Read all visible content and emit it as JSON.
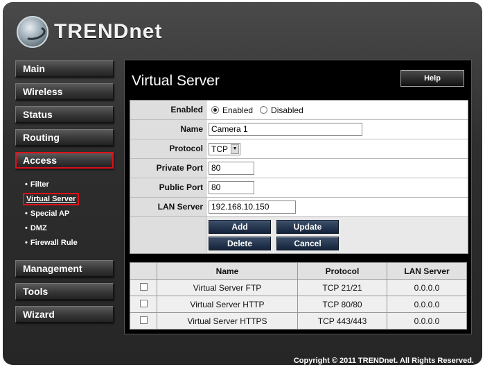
{
  "brand": {
    "name": "TRENDnet"
  },
  "sidebar": {
    "items": [
      {
        "label": "Main"
      },
      {
        "label": "Wireless"
      },
      {
        "label": "Status"
      },
      {
        "label": "Routing"
      },
      {
        "label": "Access"
      },
      {
        "label": "Management"
      },
      {
        "label": "Tools"
      },
      {
        "label": "Wizard"
      }
    ],
    "access_sub": [
      {
        "label": "Filter"
      },
      {
        "label": "Virtual Server"
      },
      {
        "label": "Special AP"
      },
      {
        "label": "DMZ"
      },
      {
        "label": "Firewall Rule"
      }
    ]
  },
  "main": {
    "title": "Virtual Server",
    "help_label": "Help",
    "form": {
      "enabled_label": "Enabled",
      "enabled_option": "Enabled",
      "disabled_option": "Disabled",
      "name_label": "Name",
      "name_value": "Camera 1",
      "protocol_label": "Protocol",
      "protocol_value": "TCP",
      "private_port_label": "Private Port",
      "private_port_value": "80",
      "public_port_label": "Public Port",
      "public_port_value": "80",
      "lan_server_label": "LAN Server",
      "lan_server_value": "192.168.10.150"
    },
    "buttons": {
      "add": "Add",
      "update": "Update",
      "delete": "Delete",
      "cancel": "Cancel"
    },
    "table": {
      "headers": [
        "",
        "Name",
        "Protocol",
        "LAN Server"
      ],
      "rows": [
        {
          "name": "Virtual Server FTP",
          "protocol": "TCP 21/21",
          "lan": "0.0.0.0"
        },
        {
          "name": "Virtual Server HTTP",
          "protocol": "TCP 80/80",
          "lan": "0.0.0.0"
        },
        {
          "name": "Virtual Server HTTPS",
          "protocol": "TCP 443/443",
          "lan": "0.0.0.0"
        }
      ]
    }
  },
  "footer": {
    "copyright": "Copyright © 2011 TRENDnet. All Rights Reserved."
  },
  "colors": {
    "highlight": "#e0101a",
    "background": "#2e2e2e",
    "button": "#1f2f48"
  }
}
